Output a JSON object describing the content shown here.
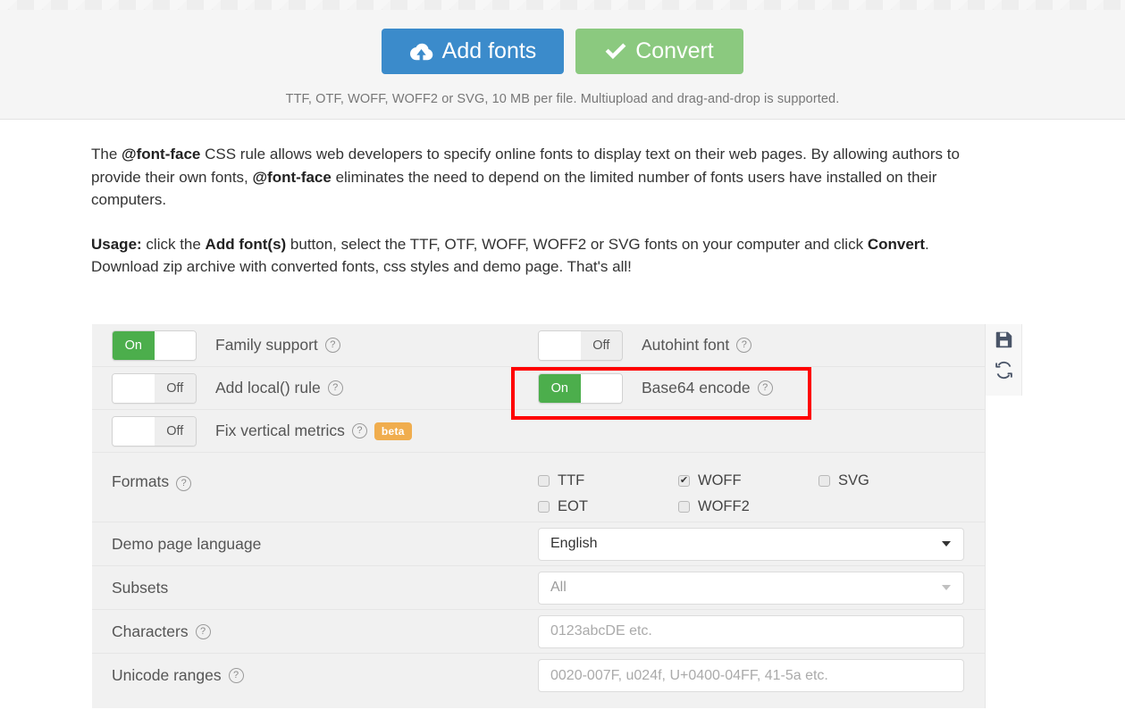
{
  "hero": {
    "add_button": "Add fonts",
    "add_icon": "cloud-upload-icon",
    "convert_button": "Convert",
    "convert_icon": "check-icon",
    "note": "TTF, OTF, WOFF, WOFF2 or SVG, 10 MB per file. Multiupload and drag-and-drop is supported.",
    "add_color": "#3b8bcb",
    "convert_color": "#8bc97f"
  },
  "intro": {
    "p1_a": "The ",
    "p1_b1": "@font-face",
    "p1_c": " CSS rule allows web developers to specify online fonts to display text on their web pages. By allowing authors to provide their own fonts, ",
    "p1_b2": "@font-face",
    "p1_d": " eliminates the need to depend on the limited number of fonts users have installed on their computers.",
    "p2_b1": "Usage:",
    "p2_a": " click the ",
    "p2_b2": "Add font(s)",
    "p2_b": " button, select the TTF, OTF, WOFF, WOFF2 or SVG fonts on your computer and click ",
    "p2_b3": "Convert",
    "p2_c": ". Download zip archive with converted fonts, css styles and demo page. That's all!"
  },
  "settings": {
    "toggles": [
      {
        "state": "On",
        "state_right": "",
        "label": "Family support",
        "help": "?"
      },
      {
        "state": "",
        "state_right": "Off",
        "label": "Autohint font",
        "help": "?"
      },
      {
        "state": "",
        "state_right": "Off",
        "label": "Add local() rule",
        "help": "?"
      },
      {
        "state": "On",
        "state_right": "",
        "label": "Base64 encode",
        "help": "?"
      },
      {
        "state": "",
        "state_right": "Off",
        "label": "Fix vertical metrics",
        "help": "?",
        "badge": "beta"
      }
    ],
    "formats": {
      "label": "Formats",
      "help": "?",
      "options": [
        {
          "name": "TTF",
          "checked": false
        },
        {
          "name": "WOFF",
          "checked": true
        },
        {
          "name": "SVG",
          "checked": false
        },
        {
          "name": "EOT",
          "checked": false
        },
        {
          "name": "WOFF2",
          "checked": false
        }
      ],
      "check_glyph": "✔"
    },
    "demo_language": {
      "label": "Demo page language",
      "value": "English"
    },
    "subsets": {
      "label": "Subsets",
      "placeholder": "All"
    },
    "characters": {
      "label": "Characters",
      "help": "?",
      "placeholder": "0123abcDE etc."
    },
    "unicode_ranges": {
      "label": "Unicode ranges",
      "help": "?",
      "placeholder": "0020-007F, u024f, U+0400-04FF, 41-5a etc."
    },
    "tools": [
      {
        "icon": "save-icon"
      },
      {
        "icon": "refresh-icon"
      }
    ],
    "highlight_color": "#ff0000"
  }
}
